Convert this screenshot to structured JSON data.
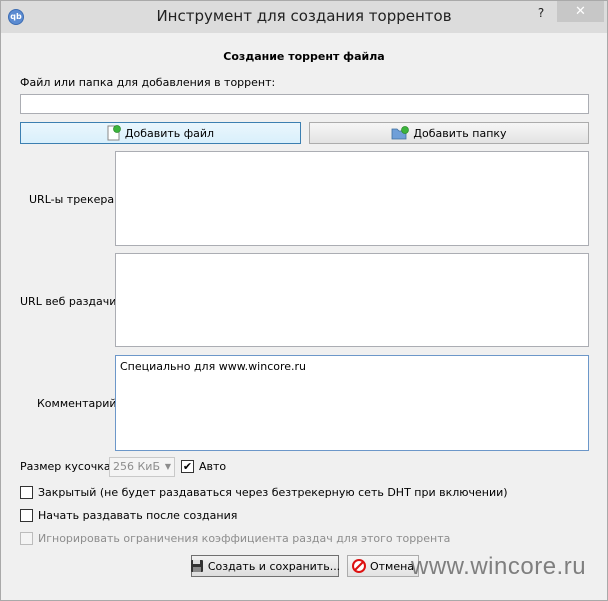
{
  "window": {
    "title": "Инструмент для создания торрентов",
    "help_label": "?",
    "close_label": "✕",
    "app_icon_text": "qb"
  },
  "heading": "Создание торрент файла",
  "source": {
    "label": "Файл или папка для добавления в торрент:",
    "value": ""
  },
  "buttons": {
    "add_file": "Добавить файл",
    "add_folder": "Добавить папку",
    "create_save": "Создать и сохранить...",
    "cancel": "Отмена"
  },
  "fields": {
    "trackers_label": "URL-ы трекера:",
    "trackers_value": "",
    "webseed_label": "URL веб раздачи:",
    "webseed_value": "",
    "comment_label": "Комментарий:",
    "comment_value": "Специально для www.wincore.ru"
  },
  "piece_size": {
    "label": "Размер кусочка:",
    "selected": "256 КиБ",
    "auto_label": "Авто",
    "auto_checked": true
  },
  "options": {
    "private_label": "Закрытый (не будет раздаваться через безтрекерную сеть DHT при включении)",
    "private_checked": false,
    "start_seeding_label": "Начать раздавать после создания",
    "start_seeding_checked": false,
    "ignore_ratio_label": "Игнорировать ограничения коэффициента раздач для этого торрента",
    "ignore_ratio_checked": false
  },
  "watermark": "www.wincore.ru",
  "icons": {
    "app": "qbittorrent-icon",
    "add_file": "add-file-icon",
    "add_folder": "add-folder-icon",
    "save": "floppy-disk-icon",
    "cancel": "cancel-icon"
  }
}
